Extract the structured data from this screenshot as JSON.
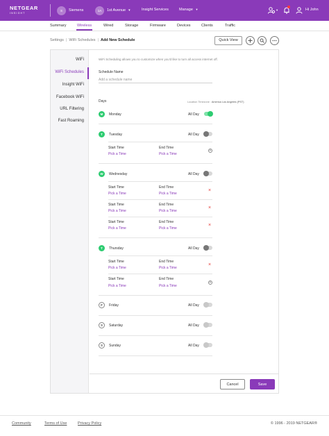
{
  "brand": {
    "name": "NETGEAR",
    "sub": "INSIGHT",
    "accent": "#8a3ab9"
  },
  "header": {
    "org": {
      "initial": "S",
      "name": "Siemens"
    },
    "location": {
      "initial": "1A",
      "name": "1st Avenue"
    },
    "links": [
      "Insight Services",
      "Manage"
    ]
  },
  "tabs": [
    "Summary",
    "Wireless",
    "Wired",
    "Storage",
    "Firmware",
    "Devices",
    "Clients",
    "Traffic"
  ],
  "active_tab": "Wireless",
  "breadcrumb": {
    "items": [
      "Settings",
      "WiFi Schedules"
    ],
    "current": "Add New Schedule"
  },
  "toolbar": {
    "quick_view": "Quick View"
  },
  "sidebar": {
    "items": [
      "WiFi",
      "WiFi Schedules",
      "Insight WiFi",
      "Facebook WiFi",
      "URL Filtering",
      "Fast Roaming"
    ],
    "active": "WiFi Schedules"
  },
  "form": {
    "description": "WiFi Scheduling allows you to customize when you'd like to turn all access internet off.",
    "name_label": "Schedule Name",
    "name_placeholder": "Add a schedule name",
    "days_label": "Days",
    "timezone_label": "Location Timezone :",
    "timezone_value": "America Los Angeles (PST)",
    "allday_label": "All Day",
    "start_label": "Start Time",
    "end_label": "End Time",
    "pick_label": "Pick a Time"
  },
  "days": [
    {
      "initial": "M",
      "name": "Monday",
      "enabled": true,
      "all_day": true
    },
    {
      "initial": "T",
      "name": "Tuesday",
      "enabled": true,
      "all_day": false
    },
    {
      "initial": "W",
      "name": "Wednesday",
      "enabled": true,
      "all_day": false
    },
    {
      "initial": "T",
      "name": "Thursday",
      "enabled": true,
      "all_day": false
    },
    {
      "initial": "F",
      "name": "Friday",
      "enabled": false,
      "all_day": false
    },
    {
      "initial": "S",
      "name": "Saturday",
      "enabled": false,
      "all_day": false
    },
    {
      "initial": "S",
      "name": "Sunday",
      "enabled": false,
      "all_day": false
    }
  ],
  "actions": {
    "cancel": "Cancel",
    "save": "Save"
  },
  "footer": {
    "links": [
      "Community",
      "Terms of Use",
      "Privacy Policy"
    ],
    "copyright": "© 1996 - 2019 NETGEAR®"
  }
}
